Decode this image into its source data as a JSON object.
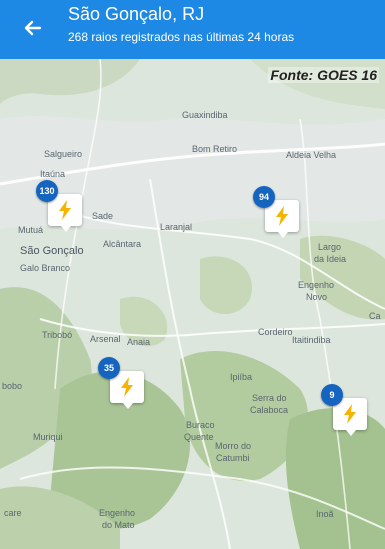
{
  "header": {
    "title": "São Gonçalo, RJ",
    "subtitle": "268 raios registrados nas últimas 24 horas",
    "back_icon": "arrow-back-icon",
    "background_color": "#1e88e5"
  },
  "map": {
    "source_label": "Fonte: GOES 16",
    "places": [
      {
        "id": "guaxindiba",
        "text": "Guaxindiba"
      },
      {
        "id": "salgueiro",
        "text": "Salgueiro"
      },
      {
        "id": "bom-retiro",
        "text": "Bom Retiro"
      },
      {
        "id": "aldeia-velha",
        "text": "Aldeia Velha"
      },
      {
        "id": "itaoca",
        "text": "Itaúna"
      },
      {
        "id": "mutua",
        "text": "Mutuá"
      },
      {
        "id": "sade",
        "text": "Sade"
      },
      {
        "id": "laranjal",
        "text": "Laranjal"
      },
      {
        "id": "sao-goncalo",
        "text": "São Gonçalo"
      },
      {
        "id": "alcantara",
        "text": "Alcântara"
      },
      {
        "id": "largo",
        "text": "Largo"
      },
      {
        "id": "da-ideia",
        "text": "da Ideia"
      },
      {
        "id": "galo-branco",
        "text": "Galo Branco"
      },
      {
        "id": "engenho-novo-1",
        "text": "Engenho"
      },
      {
        "id": "engenho-novo-2",
        "text": "Novo"
      },
      {
        "id": "tribobo",
        "text": "Tribobó"
      },
      {
        "id": "arsenal",
        "text": "Arsenal"
      },
      {
        "id": "anaia",
        "text": "Anaia"
      },
      {
        "id": "cordeiro",
        "text": "Cordeiro"
      },
      {
        "id": "itaitindiba",
        "text": "Itaitindiba"
      },
      {
        "id": "ipiiba",
        "text": "Ipiíba"
      },
      {
        "id": "serra-do",
        "text": "Serra do"
      },
      {
        "id": "calaboca",
        "text": "Calaboca"
      },
      {
        "id": "buraco-1",
        "text": "Buraco"
      },
      {
        "id": "buraco-2",
        "text": "Quente"
      },
      {
        "id": "morro-1",
        "text": "Morro do"
      },
      {
        "id": "morro-2",
        "text": "Catumbi"
      },
      {
        "id": "muriqui",
        "text": "Muriqui"
      },
      {
        "id": "engenho-mato-1",
        "text": "Engenho"
      },
      {
        "id": "engenho-mato-2",
        "text": "do Mato"
      },
      {
        "id": "inoa",
        "text": "Inoã"
      },
      {
        "id": "bobo",
        "text": "bobo"
      },
      {
        "id": "care",
        "text": "care"
      },
      {
        "id": "ca",
        "text": "Ca"
      }
    ],
    "markers": [
      {
        "id": "130",
        "count": "130",
        "icon": "lightning-icon"
      },
      {
        "id": "94",
        "count": "94",
        "icon": "lightning-icon"
      },
      {
        "id": "35",
        "count": "35",
        "icon": "lightning-icon"
      },
      {
        "id": "9",
        "count": "9",
        "icon": "lightning-icon"
      }
    ],
    "accent_color": "#1565c0",
    "lightning_color": "#f4b400"
  }
}
